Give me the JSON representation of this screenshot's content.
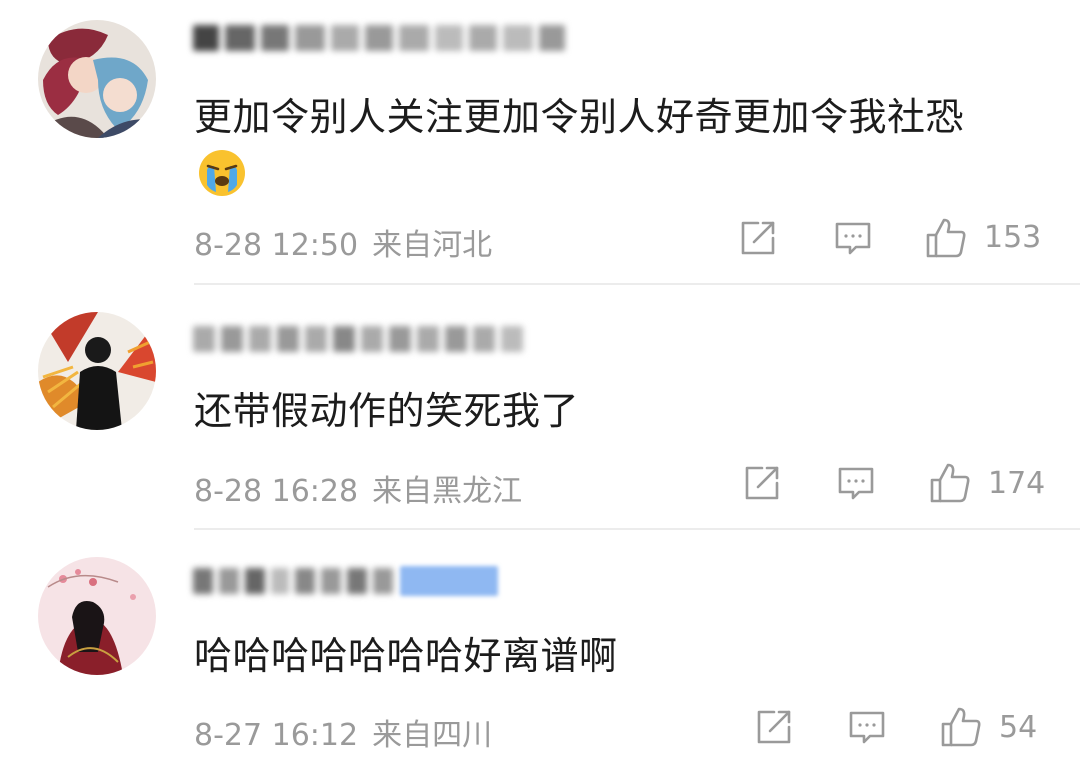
{
  "comments": [
    {
      "text": "更加令别人关注更加令别人好奇更加令我社恐",
      "emoji": "crying-emoji",
      "date": "8-28 12:50",
      "location": "来自河北",
      "likes": "153"
    },
    {
      "text": "还带假动作的笑死我了",
      "date": "8-28 16:28",
      "location": "来自黑龙江",
      "likes": "174"
    },
    {
      "text": "哈哈哈哈哈哈哈好离谱啊",
      "date": "8-27 16:12",
      "location": "来自四川",
      "likes": "54"
    }
  ],
  "icons": {
    "share": "share-icon",
    "comment": "comment-icon",
    "like": "thumbs-up-icon"
  },
  "colors": {
    "text": "#1c1c1c",
    "meta": "#9a9a9a",
    "divider": "#ececec",
    "badge": "#8fb8f2"
  }
}
